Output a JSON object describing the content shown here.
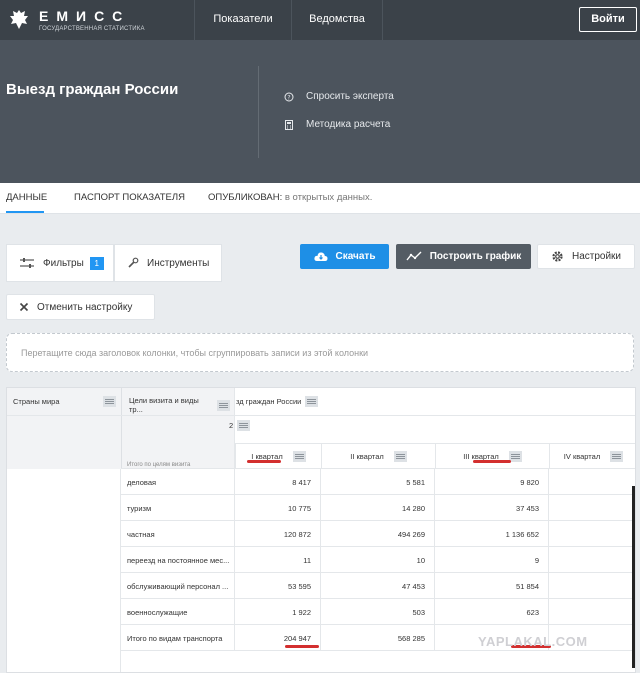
{
  "brand": {
    "title": "ЕМИСС",
    "subtitle": "ГОСУДАРСТВЕННАЯ СТАТИСТИКА"
  },
  "topnav": {
    "items": [
      "Показатели",
      "Ведомства"
    ],
    "login_label": "Войти"
  },
  "header": {
    "title": "Выезд граждан России",
    "links": [
      {
        "label": "Спросить эксперта",
        "icon": "help-circle-icon"
      },
      {
        "label": "Методика расчета",
        "icon": "calculator-icon"
      }
    ]
  },
  "tabs": {
    "data": "ДАННЫЕ",
    "passport": "ПАСПОРТ ПОКАЗАТЕЛЯ",
    "published_label": "ОПУБЛИКОВАН:",
    "published_value": "в открытых данных."
  },
  "toolbar": {
    "filters_label": "Фильтры",
    "filters_count": "1",
    "instruments_label": "Инструменты",
    "download_label": "Скачать",
    "chart_label": "Построить график",
    "settings_label": "Настройки",
    "reset_label": "Отменить настройку"
  },
  "group_zone": {
    "placeholder": "Перетащите сюда заголовок колонки, чтобы сгруппировать записи из этой колонки"
  },
  "grid": {
    "col_countries": "Страны мира",
    "col_goals": "Цели визита и виды тр...",
    "col_egress": "зд граждан России",
    "col_sub": "2",
    "quarters": [
      "I квартал",
      "II квартал",
      "III квартал",
      "IV квартал"
    ],
    "partial_first_row": "Итого по целям визита",
    "rows": [
      {
        "goal": "деловая",
        "values": [
          "8 417",
          "5 581",
          "9 820"
        ]
      },
      {
        "goal": "туризм",
        "values": [
          "10 775",
          "14 280",
          "37 453"
        ]
      },
      {
        "goal": "частная",
        "values": [
          "120 872",
          "494 269",
          "1 136 652"
        ]
      },
      {
        "goal": "переезд на постоянное мес...",
        "values": [
          "11",
          "10",
          "9"
        ]
      },
      {
        "goal": "обслуживающий персонал ...",
        "values": [
          "53 595",
          "47 453",
          "51 854"
        ]
      },
      {
        "goal": "военнослужащие",
        "values": [
          "1 922",
          "503",
          "623"
        ]
      },
      {
        "goal": "Итого по видам транспорта",
        "values": [
          "204 947",
          "568 285",
          ""
        ]
      }
    ]
  },
  "watermark": "YAPLAKAL.COM"
}
